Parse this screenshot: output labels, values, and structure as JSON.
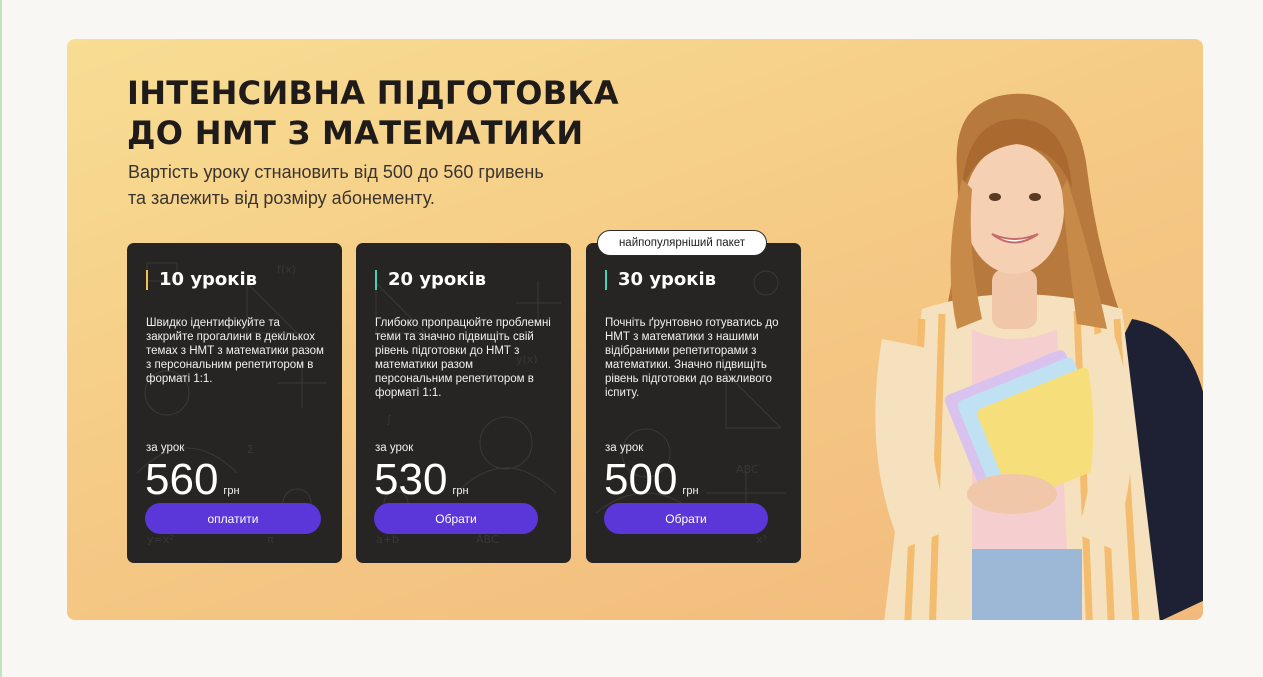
{
  "hero": {
    "title_line1": "ІНТЕНСИВНА ПІДГОТОВКА",
    "title_line2": "ДО НМТ З МАТЕМАТИКИ",
    "subtitle_line1": "Вартість уроку стнановить від 500 до 560 гривень",
    "subtitle_line2": "та залежить від розміру абонементу."
  },
  "badge": "найпопулярніший пакет",
  "cards": [
    {
      "title": "10 уроків",
      "description": "Швидко ідентифікуйте та закрийте прогалини в декількох темах з НМТ з математики разом з персональним репетитором в форматі 1:1.",
      "per_lesson": "за урок",
      "price": "560",
      "currency": "грн",
      "button": "оплатити"
    },
    {
      "title": "20 уроків",
      "description": "Глибоко пропрацюйте проблемні теми та значно підвищіть свій рівень підготовки до НМТ з математики разом персональним репетитором в форматі 1:1.",
      "per_lesson": "за урок",
      "price": "530",
      "currency": "грн",
      "button": "Обрати"
    },
    {
      "title": "30 уроків",
      "description": "Почніть ґрунтовно готуватись до НМТ з математики з нашими відібраними репетиторами з математики. Значно підвищіть рівень підготовки до важливого іспиту.",
      "per_lesson": "за урок",
      "price": "500",
      "currency": "грн",
      "button": "Обрати"
    }
  ],
  "colors": {
    "accent_button": "#5b36d8",
    "card_bg": "#262524",
    "accent_line_yellow": "#f0c050",
    "accent_line_teal": "#46d0b4"
  }
}
